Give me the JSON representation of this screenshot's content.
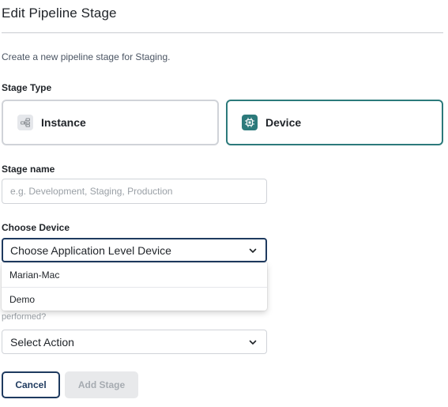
{
  "header": {
    "title": "Edit Pipeline Stage",
    "subtitle": "Create a new pipeline stage for Staging."
  },
  "stage_type": {
    "label": "Stage Type",
    "options": [
      {
        "label": "Instance",
        "icon": "instance-icon",
        "selected": false
      },
      {
        "label": "Device",
        "icon": "chip-icon",
        "selected": true
      }
    ],
    "selected_color": "#2c7a7b"
  },
  "stage_name": {
    "label": "Stage name",
    "value": "",
    "placeholder": "e.g. Development, Staging, Production"
  },
  "choose_device": {
    "label": "Choose Device",
    "selected": "Choose Application Level Device",
    "options": [
      "Marian-Mac",
      "Demo"
    ],
    "open": true
  },
  "action": {
    "partial_label": "performed?",
    "selected": "Select Action"
  },
  "buttons": {
    "cancel": "Cancel",
    "add": "Add Stage"
  },
  "colors": {
    "accent_navy": "#1e3a5f",
    "accent_teal": "#2c7a7b",
    "disabled_bg": "#e8e9eb"
  }
}
